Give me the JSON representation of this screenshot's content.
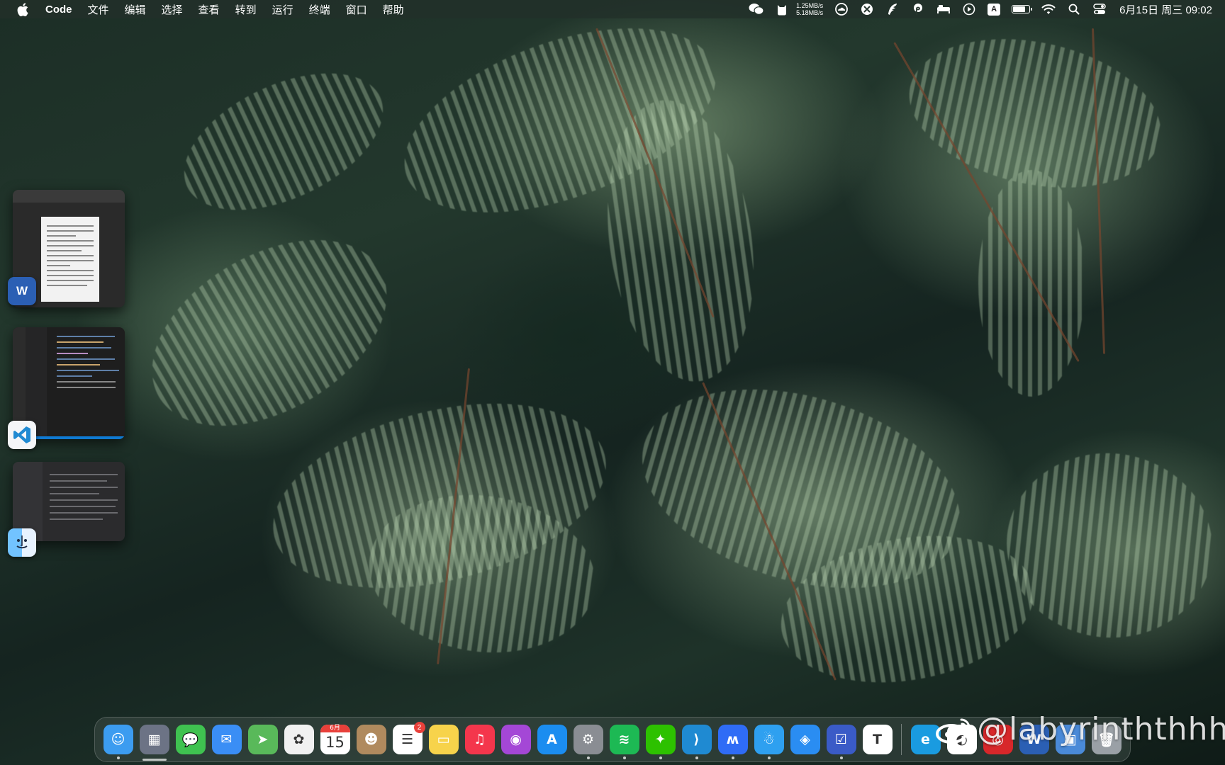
{
  "menubar": {
    "app_name": "Code",
    "items": [
      "文件",
      "编辑",
      "选择",
      "查看",
      "转到",
      "运行",
      "终端",
      "窗口",
      "帮助"
    ],
    "net_up": "1.25MB/s",
    "net_down": "5.18MB/s",
    "input_source": "A",
    "battery_level": 0.7,
    "clock": "6月15日 周三 09:02"
  },
  "stage_manager": [
    {
      "app": "Microsoft Word",
      "icon": "word-icon",
      "letter": "W",
      "color": "#2b5fb4"
    },
    {
      "app": "Visual Studio Code",
      "icon": "vscode-icon",
      "letter": "⟩",
      "color": "#1f8ad2"
    },
    {
      "app": "Finder",
      "icon": "finder-icon",
      "letter": "☺",
      "color": "#3c9cf0"
    }
  ],
  "dock": {
    "apps": [
      {
        "name": "Finder",
        "icon": "finder-icon",
        "glyph": "☺",
        "color": "#3c9cf0",
        "running": true
      },
      {
        "name": "Launchpad",
        "icon": "launchpad-icon",
        "glyph": "▦",
        "color": "#6c7385",
        "running": false
      },
      {
        "name": "Messages",
        "icon": "messages-icon",
        "glyph": "💬",
        "color": "#3fc250",
        "running": false
      },
      {
        "name": "Mail",
        "icon": "mail-icon",
        "glyph": "✉",
        "color": "#3a8ef5",
        "running": false
      },
      {
        "name": "Maps",
        "icon": "maps-icon",
        "glyph": "➤",
        "color": "#59b95a",
        "running": false
      },
      {
        "name": "Photos",
        "icon": "photos-icon",
        "glyph": "✿",
        "color": "#f1f1f1",
        "running": false
      },
      {
        "name": "Calendar",
        "icon": "calendar-icon",
        "glyph": "15",
        "month": "6月",
        "color": "#ffffff",
        "running": false
      },
      {
        "name": "Contacts",
        "icon": "contacts-icon",
        "glyph": "☻",
        "color": "#b08a5e",
        "running": false
      },
      {
        "name": "Reminders",
        "icon": "reminders-icon",
        "glyph": "☰",
        "color": "#ffffff",
        "badge": "2",
        "running": false
      },
      {
        "name": "Notes",
        "icon": "notes-icon",
        "glyph": "▭",
        "color": "#f7d34b",
        "running": false
      },
      {
        "name": "Music",
        "icon": "music-icon",
        "glyph": "♫",
        "color": "#f4364c",
        "running": false
      },
      {
        "name": "Podcasts",
        "icon": "podcasts-icon",
        "glyph": "◉",
        "color": "#a447d6",
        "running": false
      },
      {
        "name": "App Store",
        "icon": "appstore-icon",
        "glyph": "A",
        "color": "#1b8df0",
        "running": false
      },
      {
        "name": "System Preferences",
        "icon": "settings-icon",
        "glyph": "⚙",
        "color": "#8a8d93",
        "running": true
      },
      {
        "name": "Spotify",
        "icon": "spotify-icon",
        "glyph": "≋",
        "color": "#1db954",
        "running": true
      },
      {
        "name": "WeChat",
        "icon": "wechat-icon",
        "glyph": "✦",
        "color": "#2dc100",
        "running": true
      },
      {
        "name": "Visual Studio Code",
        "icon": "vscode-icon",
        "glyph": "⟩",
        "color": "#1f8ad2",
        "running": true
      },
      {
        "name": "Lark",
        "icon": "lark-icon",
        "glyph": "ʍ",
        "color": "#2f6cf6",
        "running": true
      },
      {
        "name": "QQ",
        "icon": "qq-icon",
        "glyph": "☃",
        "color": "#2ea0f0",
        "running": true
      },
      {
        "name": "Safari",
        "icon": "safari-icon",
        "glyph": "◈",
        "color": "#2a8df2",
        "running": false
      },
      {
        "name": "OmniFocus",
        "icon": "tasks-icon",
        "glyph": "☑",
        "color": "#3a5bc7",
        "running": true
      },
      {
        "name": "Typora",
        "icon": "typora-icon",
        "glyph": "T",
        "color": "#ffffff",
        "running": false
      }
    ],
    "recent": [
      {
        "name": "Edge",
        "icon": "edge-icon",
        "glyph": "e",
        "color": "#1a9be0"
      },
      {
        "name": "Weibo",
        "icon": "weibo-icon",
        "glyph": "◐",
        "color": "#ffffff"
      },
      {
        "name": "NetEase Music",
        "icon": "netease-icon",
        "glyph": "◎",
        "color": "#d8272a"
      },
      {
        "name": "Word",
        "icon": "word-icon",
        "glyph": "W",
        "color": "#2b5fb4"
      },
      {
        "name": "Preview",
        "icon": "preview-icon",
        "glyph": "▣",
        "color": "#4a8ad8"
      },
      {
        "name": "Trash",
        "icon": "trash-icon",
        "glyph": "🗑",
        "color": "#9aa0a6"
      }
    ]
  },
  "watermark": "@labyrinththhh"
}
